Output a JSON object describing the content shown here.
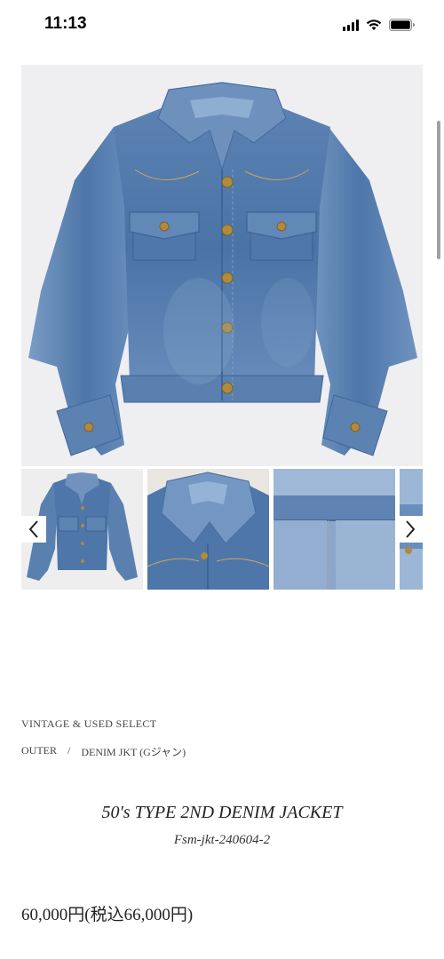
{
  "status_bar": {
    "time": "11:13"
  },
  "gallery": {
    "main_image": "denim-jacket-front-photo",
    "thumbnails": [
      "jacket-front",
      "jacket-collar-closeup",
      "jacket-fabric-closeup",
      "jacket-partial"
    ],
    "prev_icon": "chevron-left-icon",
    "next_icon": "chevron-right-icon"
  },
  "product": {
    "category": "VINTAGE & USED SELECT",
    "breadcrumb": {
      "level1": "OUTER",
      "separator": "/",
      "level2": "DENIM JKT (Gジャン)"
    },
    "title": "50's TYPE 2ND DENIM JACKET",
    "code": "Fsm-jkt-240604-2",
    "price": "60,000円(税込66,000円)"
  },
  "colors": {
    "denim": "#4f77a8",
    "denim_light": "#7d9fc6",
    "denim_dark": "#355a86",
    "button_gold": "#b08a3e"
  }
}
